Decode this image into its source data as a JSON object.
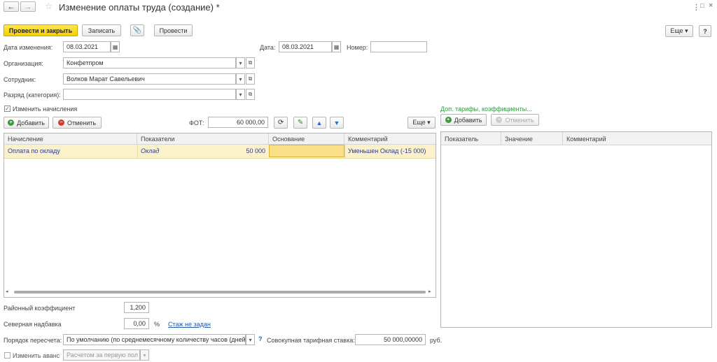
{
  "header": {
    "title": "Изменение оплаты труда (создание) *",
    "back": "←",
    "forward": "→",
    "more": "⋮",
    "restore": "□",
    "close": "×"
  },
  "toolbar": {
    "post_close": "Провести и закрыть",
    "save": "Записать",
    "post": "Провести",
    "more": "Еще ▾",
    "help": "?"
  },
  "form": {
    "date_change_label": "Дата изменения:",
    "date_change_value": "08.03.2021",
    "date_label": "Дата:",
    "date_value": "08.03.2021",
    "number_label": "Номер:",
    "number_value": "",
    "org_label": "Организация:",
    "org_value": "Конфетпром",
    "employee_label": "Сотрудник:",
    "employee_value": "Волков Марат Савельевич",
    "grade_label": "Разряд (категория):",
    "grade_value": ""
  },
  "accruals": {
    "checkbox_label": "Изменить начисления",
    "add_label": "Добавить",
    "cancel_label": "Отменить",
    "fot_label": "ФОТ:",
    "fot_value": "60 000,00",
    "more_label": "Еще ▾",
    "columns": [
      "Начисление",
      "Показатели",
      "Основание",
      "Комментарий"
    ],
    "rows": [
      {
        "accrual": "Оплата по окладу",
        "indicator": "Оклад",
        "amount": "50 000",
        "basis": "",
        "comment": "Уменьшен Оклад (-15 000)"
      }
    ]
  },
  "tariffs": {
    "link": "Доп. тарифы, коэффициенты...",
    "add_label": "Добавить",
    "cancel_label": "Отменить",
    "columns": [
      "Показатель",
      "Значение",
      "Комментарий"
    ]
  },
  "bottom": {
    "district_label": "Районный коэффициент",
    "district_value": "1,200",
    "north_label": "Северная надбавка",
    "north_value": "0,00",
    "north_unit": "%",
    "north_link": "Стаж не задан",
    "recalc_label": "Порядок пересчета:",
    "recalc_value": "По умолчанию (по среднемесячному количеству часов (дней))",
    "help": "?",
    "total_label": "Совокупная тарифная ставка:",
    "total_value": "50 000,00000",
    "total_unit": "руб.",
    "advance_label": "Изменить аванс",
    "advance_value": "Расчетом за первую пол"
  },
  "colors": {
    "primary": "#f5d300",
    "selected_row": "#fbf2cc",
    "edit_cell": "#fbe08a",
    "link_green": "#2a9a3a",
    "link_blue": "#2659a8",
    "row_text": "#2b3a8a"
  }
}
